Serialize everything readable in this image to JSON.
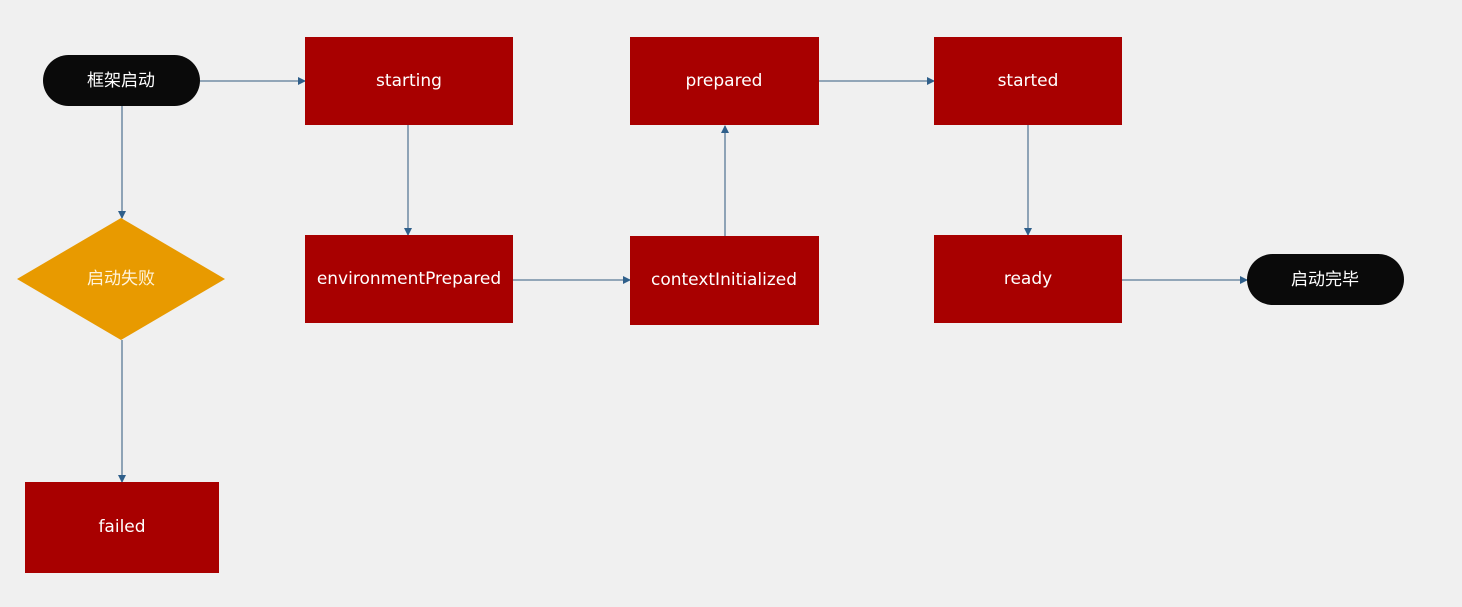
{
  "diagram": {
    "type": "flowchart",
    "colors": {
      "background": "#f0f0f0",
      "state": "#a80000",
      "terminal": "#0a0a0a",
      "decision": "#e89a00",
      "edge": "#5a7a96"
    },
    "nodes": [
      {
        "id": "framework-start",
        "label": "框架启动",
        "shape": "terminal"
      },
      {
        "id": "starting",
        "label": "starting",
        "shape": "rect"
      },
      {
        "id": "environment-prepared",
        "label": "environmentPrepared",
        "shape": "rect"
      },
      {
        "id": "context-initialized",
        "label": "contextInitialized",
        "shape": "rect"
      },
      {
        "id": "prepared",
        "label": "prepared",
        "shape": "rect"
      },
      {
        "id": "started",
        "label": "started",
        "shape": "rect"
      },
      {
        "id": "ready",
        "label": "ready",
        "shape": "rect"
      },
      {
        "id": "startup-complete",
        "label": "启动完毕",
        "shape": "terminal"
      },
      {
        "id": "startup-failed",
        "label": "启动失败",
        "shape": "decision"
      },
      {
        "id": "failed",
        "label": "failed",
        "shape": "rect"
      }
    ],
    "edges": [
      {
        "from": "framework-start",
        "to": "starting"
      },
      {
        "from": "starting",
        "to": "environment-prepared"
      },
      {
        "from": "environment-prepared",
        "to": "context-initialized"
      },
      {
        "from": "context-initialized",
        "to": "prepared"
      },
      {
        "from": "prepared",
        "to": "started"
      },
      {
        "from": "started",
        "to": "ready"
      },
      {
        "from": "ready",
        "to": "startup-complete"
      },
      {
        "from": "framework-start",
        "to": "startup-failed"
      },
      {
        "from": "startup-failed",
        "to": "failed"
      }
    ]
  }
}
